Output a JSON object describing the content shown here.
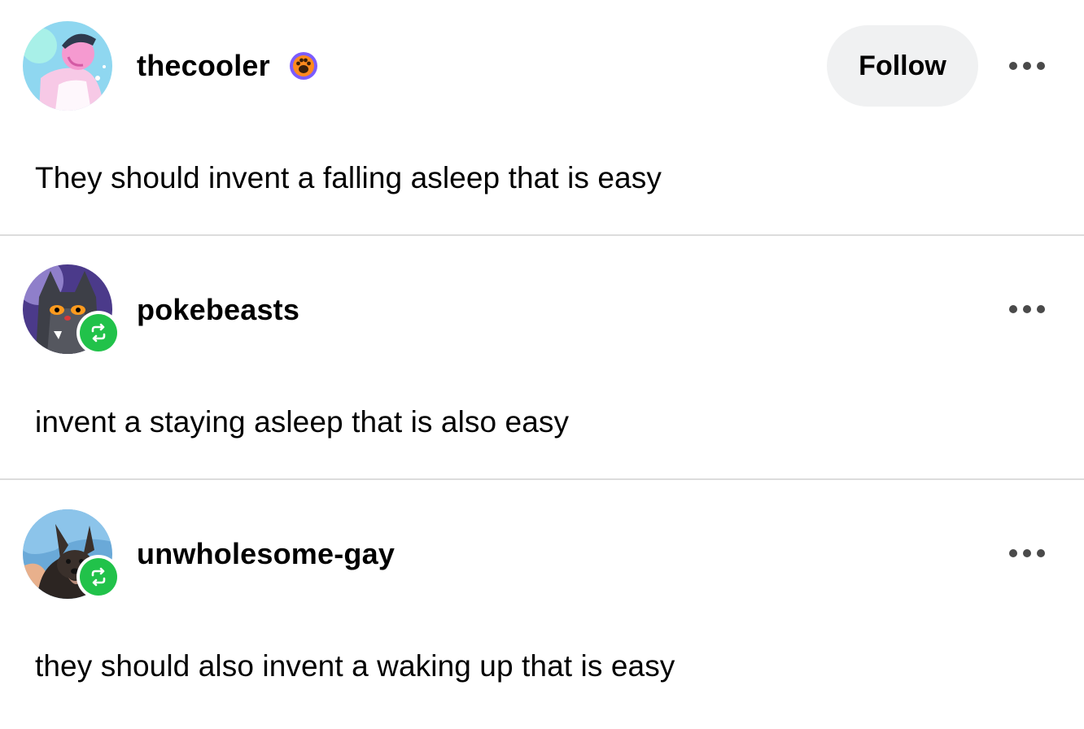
{
  "posts": [
    {
      "username": "thecooler",
      "badge": "paw-badge-icon",
      "follow_label": "Follow",
      "more_icon": "ellipsis-icon",
      "text": "They should invent a falling asleep that is easy"
    },
    {
      "username": "pokebeasts",
      "reblog_icon": "reblog-icon",
      "more_icon": "ellipsis-icon",
      "text": "invent a staying asleep that is also easy"
    },
    {
      "username": "unwholesome-gay",
      "reblog_icon": "reblog-icon",
      "more_icon": "ellipsis-icon",
      "text": "they should also invent a waking up that is easy"
    }
  ],
  "colors": {
    "follow_bg": "#f0f1f2",
    "reblog_green": "#21c24a",
    "divider": "#dcdcdc",
    "badge_purple": "#7b5cff",
    "badge_orange": "#ff8a1f"
  }
}
